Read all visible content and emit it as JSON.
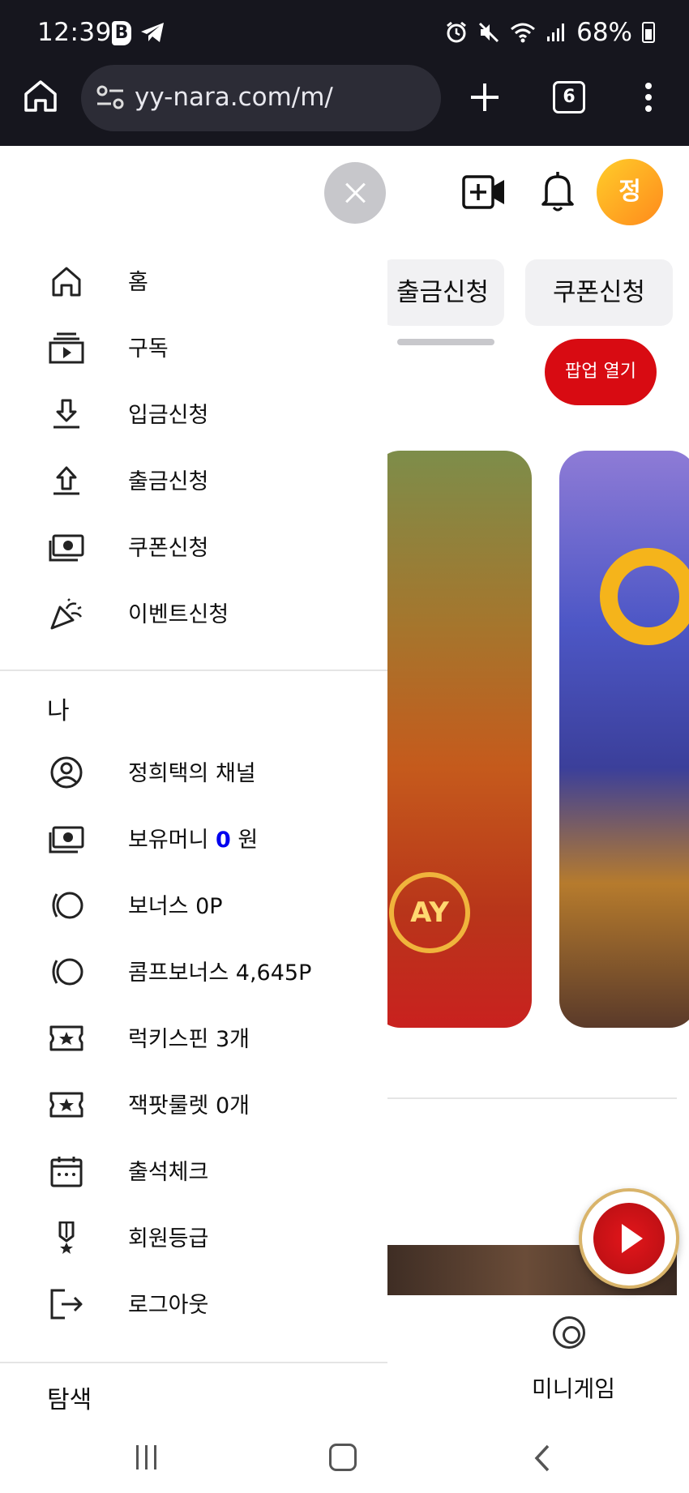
{
  "status_bar": {
    "time": "12:39",
    "battery": "68%"
  },
  "browser": {
    "url": "yy-nara.com/m/",
    "tab_count": "6"
  },
  "page": {
    "avatar_initial": "정",
    "chips": [
      "출금신청",
      "쿠폰신청"
    ],
    "popup_button": "팝업 열기",
    "mini_game_label": "미니게임"
  },
  "drawer": {
    "nav_items": [
      {
        "icon": "home-icon",
        "label": "홈"
      },
      {
        "icon": "subscriptions-icon",
        "label": "구독"
      },
      {
        "icon": "deposit-icon",
        "label": "입금신청"
      },
      {
        "icon": "withdraw-icon",
        "label": "출금신청"
      },
      {
        "icon": "cash-icon",
        "label": "쿠폰신청"
      },
      {
        "icon": "party-popper-icon",
        "label": "이벤트신청"
      }
    ],
    "me_section_title": "나",
    "me_items": [
      {
        "icon": "user-circle-icon",
        "label": "정희택의 채널"
      },
      {
        "icon": "cash-icon",
        "label_prefix": "보유머니 ",
        "amount": "0",
        "label_suffix": " 원"
      },
      {
        "icon": "coin-icon",
        "label": "보너스 0P"
      },
      {
        "icon": "coin-icon",
        "label": "콤프보너스 4,645P"
      },
      {
        "icon": "ticket-star-icon",
        "label": "럭키스핀 3개"
      },
      {
        "icon": "ticket-star-icon",
        "label": "잭팟룰렛 0개"
      },
      {
        "icon": "calendar-icon",
        "label": "출석체크"
      },
      {
        "icon": "medal-icon",
        "label": "회원등급"
      },
      {
        "icon": "logout-icon",
        "label": "로그아웃"
      }
    ],
    "explore_section_title": "탐색"
  }
}
